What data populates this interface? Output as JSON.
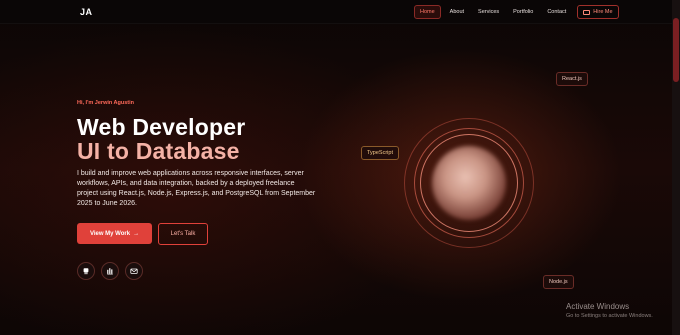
{
  "nav": {
    "logo": "JA",
    "links": [
      "Home",
      "About",
      "Services",
      "Portfolio",
      "Contact"
    ],
    "hire_label": "Hire Me"
  },
  "hero": {
    "greeting": "Hi, I'm Jerwin Agustin",
    "title_line1": "Web Developer",
    "title_line2": "UI to Database",
    "description": "I build and improve web applications across responsive interfaces, server workflows, APIs, and data integration, backed by a deployed freelance project using React.js, Node.js, Express.js, and PostgreSQL from September 2025 to June 2026.",
    "primary_cta": "View My Work",
    "primary_cta_arrow": "→",
    "secondary_cta": "Let's Talk"
  },
  "tech_badges": {
    "react": "React.js",
    "typescript": "TypeScript",
    "node": "Node.js"
  },
  "socials": [
    "github-icon",
    "linkedin-icon",
    "email-icon"
  ],
  "windows_watermark": {
    "title": "Activate Windows",
    "subtitle": "Go to Settings to activate Windows."
  },
  "colors": {
    "accent": "#e0413a",
    "accent_light": "#f4b2a6",
    "background": "#0e0706"
  }
}
